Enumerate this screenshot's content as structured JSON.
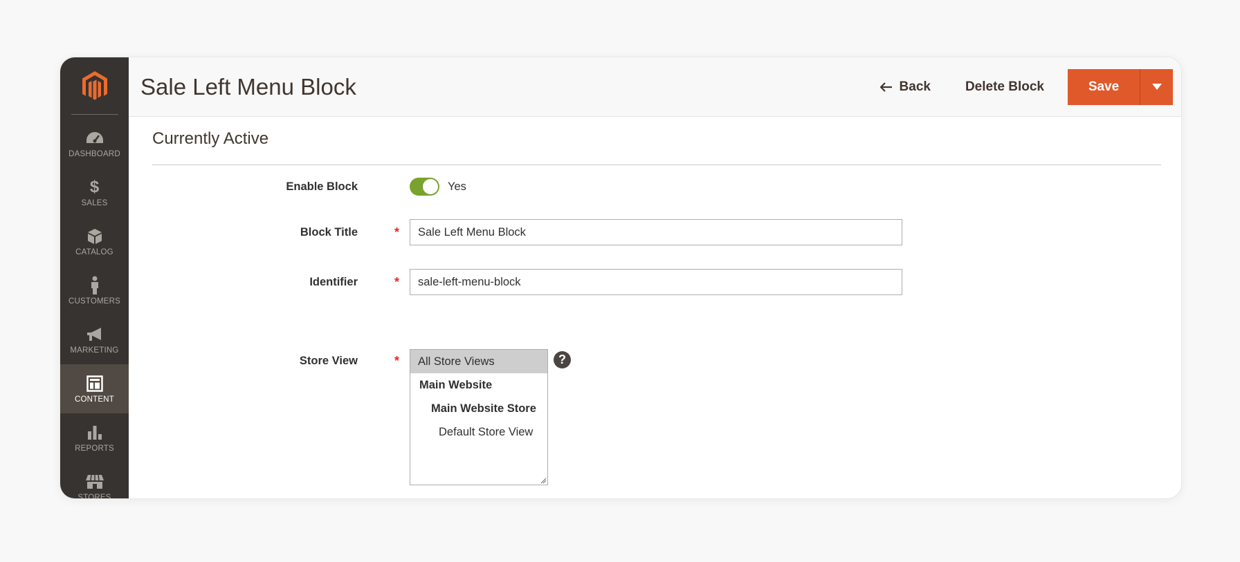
{
  "header": {
    "title": "Sale Left Menu Block",
    "back_label": "Back",
    "delete_label": "Delete Block",
    "save_label": "Save"
  },
  "sidebar": {
    "items": [
      {
        "label": "DASHBOARD",
        "icon": "dashboard-icon"
      },
      {
        "label": "SALES",
        "icon": "dollar-icon"
      },
      {
        "label": "CATALOG",
        "icon": "box-icon"
      },
      {
        "label": "CUSTOMERS",
        "icon": "person-icon"
      },
      {
        "label": "MARKETING",
        "icon": "megaphone-icon"
      },
      {
        "label": "CONTENT",
        "icon": "layout-icon",
        "active": true
      },
      {
        "label": "REPORTS",
        "icon": "bar-chart-icon"
      },
      {
        "label": "STORES",
        "icon": "storefront-icon"
      }
    ]
  },
  "section": {
    "title": "Currently Active"
  },
  "form": {
    "enable_block": {
      "label": "Enable Block",
      "value_text": "Yes",
      "enabled": true
    },
    "block_title": {
      "label": "Block Title",
      "value": "Sale Left Menu Block",
      "required": true
    },
    "identifier": {
      "label": "Identifier",
      "value": "sale-left-menu-block",
      "required": true
    },
    "store_view": {
      "label": "Store View",
      "required": true,
      "options": [
        {
          "label": "All Store Views",
          "selected": true
        },
        {
          "label": "Main Website"
        },
        {
          "label": "Main Website Store"
        },
        {
          "label": "Default Store View"
        }
      ],
      "help": "?"
    }
  },
  "colors": {
    "accent": "#e0592a",
    "sidebar_bg": "#373330",
    "sidebar_active": "#514943",
    "toggle_on": "#79a22e",
    "required": "#e02b27"
  }
}
